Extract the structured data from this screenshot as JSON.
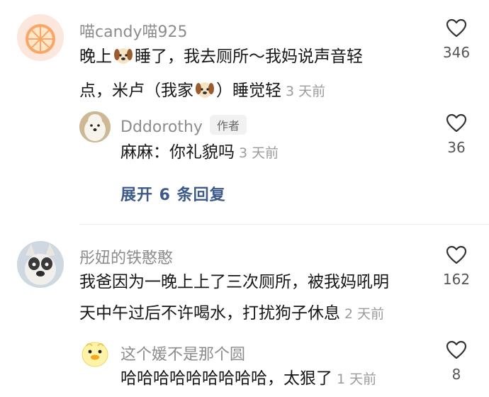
{
  "comments": [
    {
      "username": "喵candy喵925",
      "text_part1": "晚上",
      "text_part2": "睡了，我去厕所～我妈说声音轻",
      "text_line2_a": "点，米卢（我家",
      "text_line2_b": "）睡觉轻",
      "time": "3 天前",
      "likes": "346",
      "emoji": "dog-face",
      "replies": [
        {
          "username": "Dddorothy",
          "badge": "作者",
          "text": "麻麻：你礼貌吗",
          "time": "3 天前",
          "likes": "36"
        }
      ],
      "expand_label": "展开 6 条回复"
    },
    {
      "username": "彤妞的铁憨憨",
      "text_line1": "我爸因为一晚上上了三次厕所，被我妈吼明",
      "text_line2": "天中午过后不许喝水，打扰狗子休息",
      "time": "2 天前",
      "likes": "162",
      "replies": [
        {
          "username": "这个媛不是那个圆",
          "text": "哈哈哈哈哈哈哈哈哈，太狠了",
          "time": "1 天前",
          "likes": "8"
        }
      ]
    }
  ],
  "colors": {
    "username": "#8c8c8c",
    "expand": "#3d5a8a",
    "meta": "#9b9b9b"
  },
  "icons": {
    "like": "heart-outline-icon",
    "emoji": "dog-face"
  }
}
